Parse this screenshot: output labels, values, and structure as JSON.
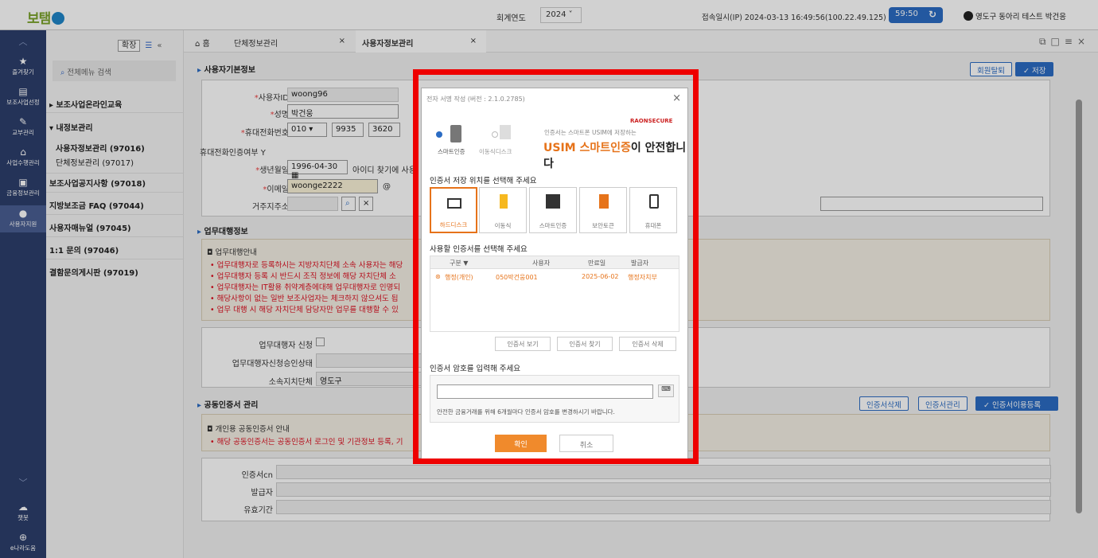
{
  "topbar": {
    "logo": "보탬",
    "year_label": "회계연도",
    "year": "2024 ˅",
    "login_info": "접속일시(IP)  2024-03-13 16:49:56(100.22.49.125)",
    "timer": "59:50",
    "user": "영도구 동아리 테스트 박건응"
  },
  "rail": [
    {
      "label": "즐겨찾기",
      "icon": "★"
    },
    {
      "label": "보조사업선정",
      "icon": "▤"
    },
    {
      "label": "교부관리",
      "icon": "✎"
    },
    {
      "label": "사업수행관리",
      "icon": "⌂"
    },
    {
      "label": "금융정보관리",
      "icon": "▣"
    },
    {
      "label": "사용자지원",
      "icon": "●"
    },
    {
      "label": "챗봇",
      "icon": "☁"
    },
    {
      "label": "e나라도움",
      "icon": "⊕"
    }
  ],
  "menu": {
    "expand": "확장",
    "search_placeholder": "전체메뉴 검색",
    "items": [
      "보조사업온라인교육",
      "내정보관리",
      "보조사업공지사항 (97018)",
      "지방보조금 FAQ (97044)",
      "사용자매뉴얼 (97045)",
      "1:1 문의 (97046)",
      "결함문의게시판 (97019)"
    ],
    "subs": [
      "사용자정보관리 (97016)",
      "단체정보관리 (97017)"
    ]
  },
  "tabs": [
    "홈",
    "단체정보관리",
    "사용자정보관리"
  ],
  "basic": {
    "title": "사용자기본정보",
    "withdraw": "회원탈퇴",
    "save": "✓ 저장",
    "fields": {
      "id_label": "사용자ID",
      "id": "woong96",
      "name_label": "성명",
      "name": "박건웅",
      "phone_label": "휴대전화번호",
      "phone1": "010",
      "phone2": "9935",
      "phone3": "3620",
      "cert_label": "휴대전화인증여부",
      "cert": "Y",
      "birth_label": "생년월일",
      "birth": "1996-04-30",
      "id_find": "아이디 찾기에 사용",
      "email_label": "이메일",
      "email": "woonge2222",
      "at": "@",
      "addr_label": "거주지주소"
    }
  },
  "agent": {
    "title": "업무대행정보",
    "notice_title": "업무대행안내",
    "notices": [
      "업무대행자로 등록하시는 지방자치단체 소속 사용자는 해당",
      "업무대행자 등록 시 반드시 조직 정보에 해당 자치단체 소",
      "업무대행자는 IT활용 취약계층에대해 업무대행자로 인명되",
      "해당사항이 없는 일반 보조사업자는 체크하지 않으셔도 됩",
      "업무 대행 시 해당 자치단체 담당자만 업무를 대행할 수 있"
    ],
    "apply_label": "업무대행자 신청",
    "status_label": "업무대행자신청승인상태",
    "org_label": "소속지치단체",
    "org": "영도구"
  },
  "cert": {
    "title": "공동인증서 관리",
    "delete": "인증서삭제",
    "manage": "인증서관리",
    "register": "✓ 인증서이용등록",
    "notice_title": "개인용 공동인증서 안내",
    "notice": "해당 공동인증서는 공동인증서 로그인 및 기관정보 등록, 기",
    "cn_label": "인증서cn",
    "issuer_label": "발급자",
    "valid_label": "유효기간"
  },
  "dialog": {
    "title": "전자 서명 작성 (버전 : 2.1.0.2785)",
    "brand": "RAONSECURE",
    "radio1": "스마트인증",
    "radio2": "이동식디스크",
    "usim_small1": "인증서는 스마트폰 USIM에 저장하는",
    "usim_big1": "USIM 스마트인증",
    "usim_big2": "이 안전합니다",
    "loc_heading": "인증서 저장 위치를 선택해 주세요",
    "locations": [
      "하드디스크",
      "이동식",
      "스마트인증",
      "보안토큰",
      "휴대폰"
    ],
    "cert_heading": "사용할 인증서를 선택해 주세요",
    "columns": [
      "구분 ▼",
      "사용자",
      "만료일",
      "발급자"
    ],
    "row": [
      "행정(개인)",
      "050박건웅001",
      "2025-06-02",
      "행정자치부"
    ],
    "btn_view": "인증서 보기",
    "btn_find": "인증서 찾기",
    "btn_delete": "인증서 삭제",
    "pw_heading": "인증서 암호를 입력해 주세요",
    "pw_note": "안전한 금융거래를 위해 6개월마다 인증서 암호를 변경하시기 바랍니다.",
    "ok": "확인",
    "cancel": "취소"
  },
  "colors": {
    "accent": "#2b6cc4",
    "highlight": "#ee0000",
    "orange": "#e6731a"
  }
}
